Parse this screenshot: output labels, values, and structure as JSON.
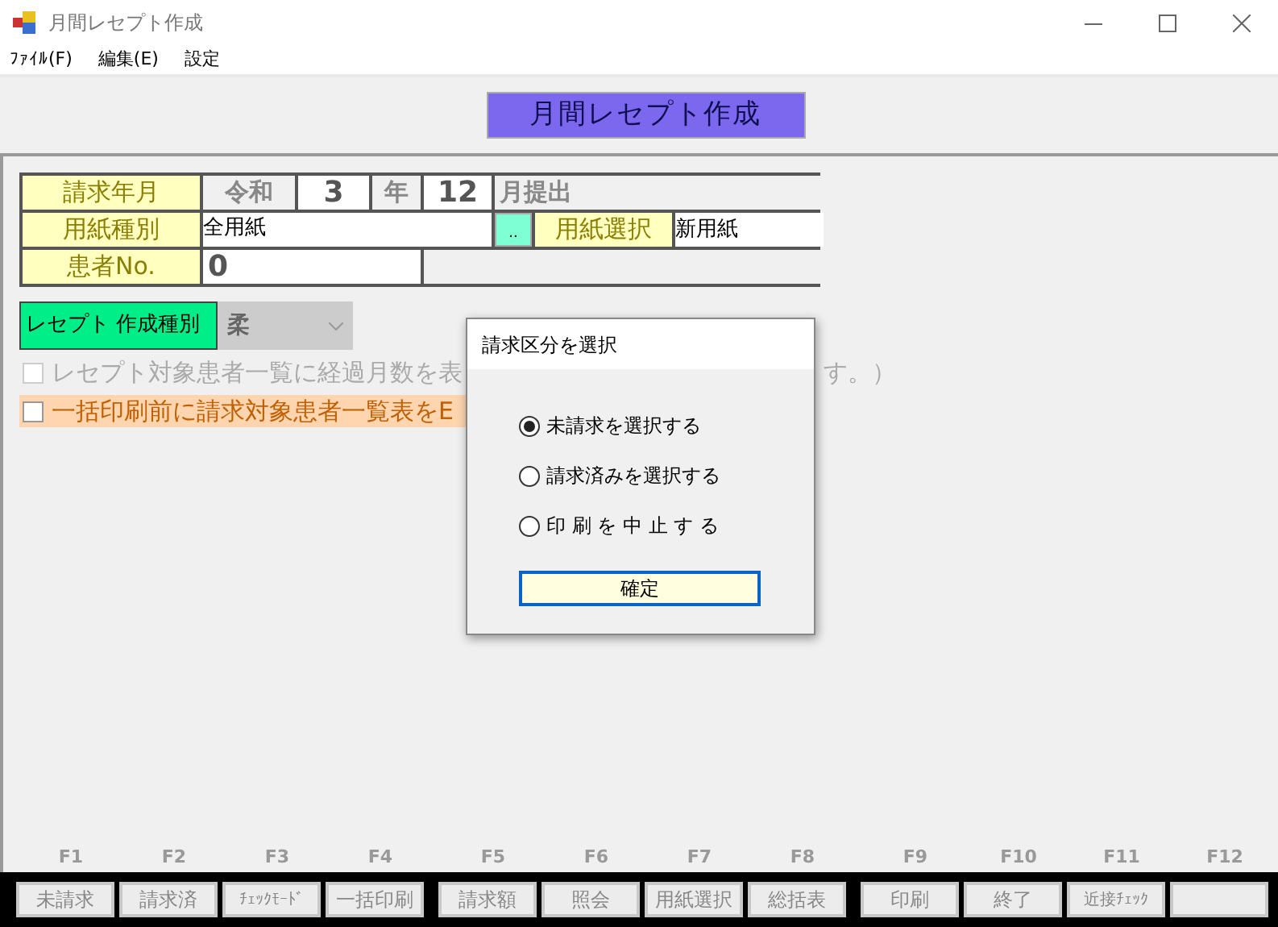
{
  "window": {
    "title": "月間レセプト作成"
  },
  "menu": [
    {
      "label": "ﾌｧｲﾙ(F)"
    },
    {
      "label": "編集(E)"
    },
    {
      "label": "設定"
    }
  ],
  "banner": "月間レセプト作成",
  "form": {
    "billing_month": {
      "label": "請求年月",
      "era": "令和",
      "year": "3",
      "year_unit": "年",
      "month": "12",
      "month_unit": "月提出"
    },
    "paper_type": {
      "label": "用紙種別",
      "value": "全用紙",
      "button": "..",
      "select_label": "用紙選択",
      "select_value": "新用紙"
    },
    "patient_no": {
      "label": "患者No.",
      "value": "0"
    },
    "receipt_type": {
      "label": "レセプト 作成種別",
      "value": "柔",
      "disabled": true
    },
    "checkboxes": [
      {
        "label": "レセプト対象患者一覧に経過月数を表",
        "label_tail": "す。）",
        "checked": false,
        "disabled": true
      },
      {
        "label": "一括印刷前に請求対象患者一覧表をE",
        "checked": false,
        "disabled": false
      }
    ]
  },
  "dialog": {
    "title": "請求区分を選択",
    "options": [
      {
        "label": "未請求を選択する",
        "selected": true
      },
      {
        "label": "請求済みを選択する",
        "selected": false
      },
      {
        "label": "印 刷 を 中 止 す る",
        "selected": false
      }
    ],
    "button": "確定"
  },
  "function_keys": [
    {
      "key": "F1",
      "label": "未請求"
    },
    {
      "key": "F2",
      "label": "請求済"
    },
    {
      "key": "F3",
      "label": "ﾁｪｯｸﾓｰﾄﾞ"
    },
    {
      "key": "F4",
      "label": "一括印刷"
    },
    {
      "key": "F5",
      "label": "請求額"
    },
    {
      "key": "F6",
      "label": "照会"
    },
    {
      "key": "F7",
      "label": "用紙選択"
    },
    {
      "key": "F8",
      "label": "総括表"
    },
    {
      "key": "F9",
      "label": "印刷"
    },
    {
      "key": "F10",
      "label": "終了"
    },
    {
      "key": "F11",
      "label": "近接ﾁｪｯｸ"
    },
    {
      "key": "F12"
    }
  ]
}
